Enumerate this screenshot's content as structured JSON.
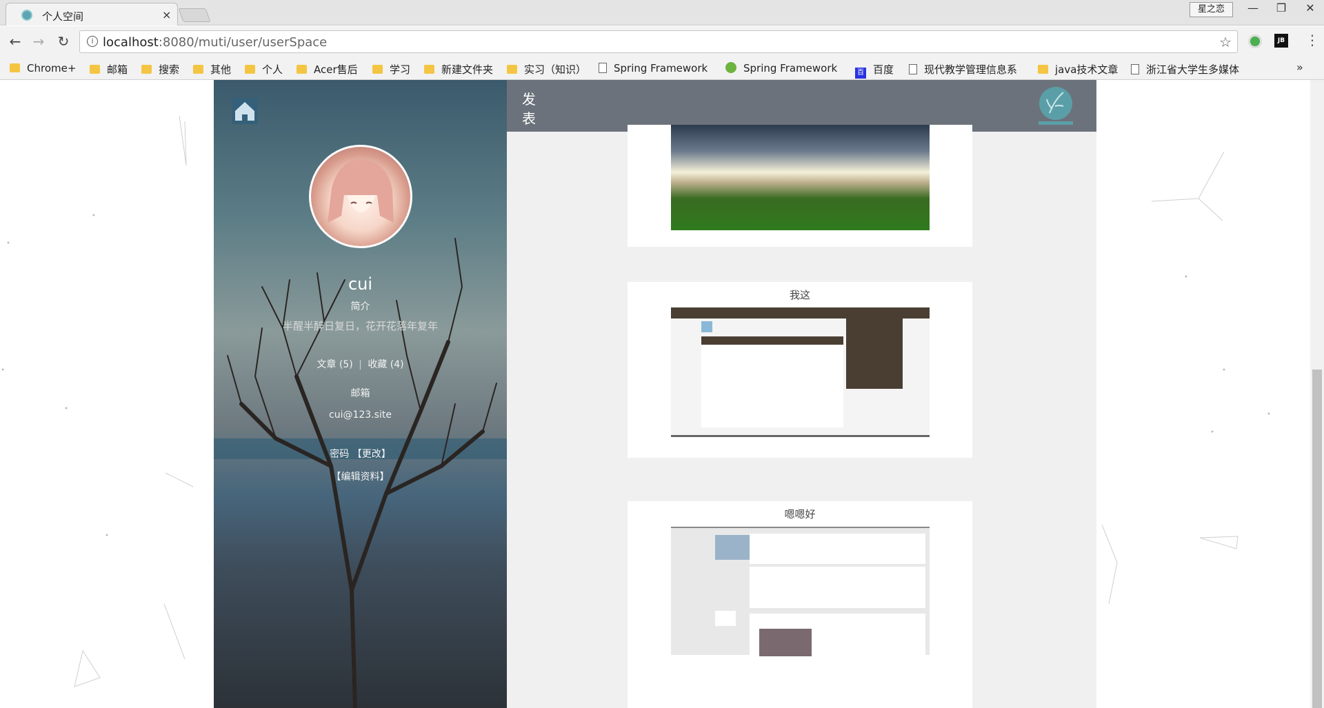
{
  "browser": {
    "tab_title": "个人空间",
    "tab_close": "×",
    "profile_button": "星之恋",
    "window_controls": [
      "—",
      "❐",
      "✕"
    ],
    "url_host": "localhost",
    "url_path": ":8080/muti/user/userSpace",
    "bookmarks": [
      {
        "label": "Chrome+",
        "icon": "folder-icon"
      },
      {
        "label": "邮箱",
        "icon": "folder-icon"
      },
      {
        "label": "搜索",
        "icon": "folder-icon"
      },
      {
        "label": "其他",
        "icon": "folder-icon"
      },
      {
        "label": "个人",
        "icon": "folder-icon"
      },
      {
        "label": "Acer售后",
        "icon": "folder-icon"
      },
      {
        "label": "学习",
        "icon": "folder-icon"
      },
      {
        "label": "新建文件夹",
        "icon": "folder-icon"
      },
      {
        "label": "实习（知识）",
        "icon": "folder-icon"
      },
      {
        "label": "Spring Framework",
        "icon": "page-icon"
      },
      {
        "label": "Spring Framework",
        "icon": "spring-leaf-icon"
      },
      {
        "label": "百度",
        "icon": "baidu-paw-icon"
      },
      {
        "label": "现代教学管理信息系",
        "icon": "page-icon"
      },
      {
        "label": "java技术文章",
        "icon": "folder-icon"
      },
      {
        "label": "浙江省大学生多媒体",
        "icon": "page-icon"
      }
    ],
    "bookmarks_more": "»"
  },
  "profile": {
    "username": "cui",
    "intro_label": "简介",
    "intro_text": "半醒半醉日复日，花开花落年复年",
    "articles": "文章 (5)",
    "favorites": "收藏 (4)",
    "email_label": "邮箱",
    "email": "cui@123.site",
    "password_label": "密码",
    "change_password": "【更改】",
    "edit_profile": "【编辑资料】"
  },
  "header": {
    "publish": "发表"
  },
  "posts": [
    {
      "title": ""
    },
    {
      "title": "我这"
    },
    {
      "title": "嗯嗯好"
    }
  ]
}
